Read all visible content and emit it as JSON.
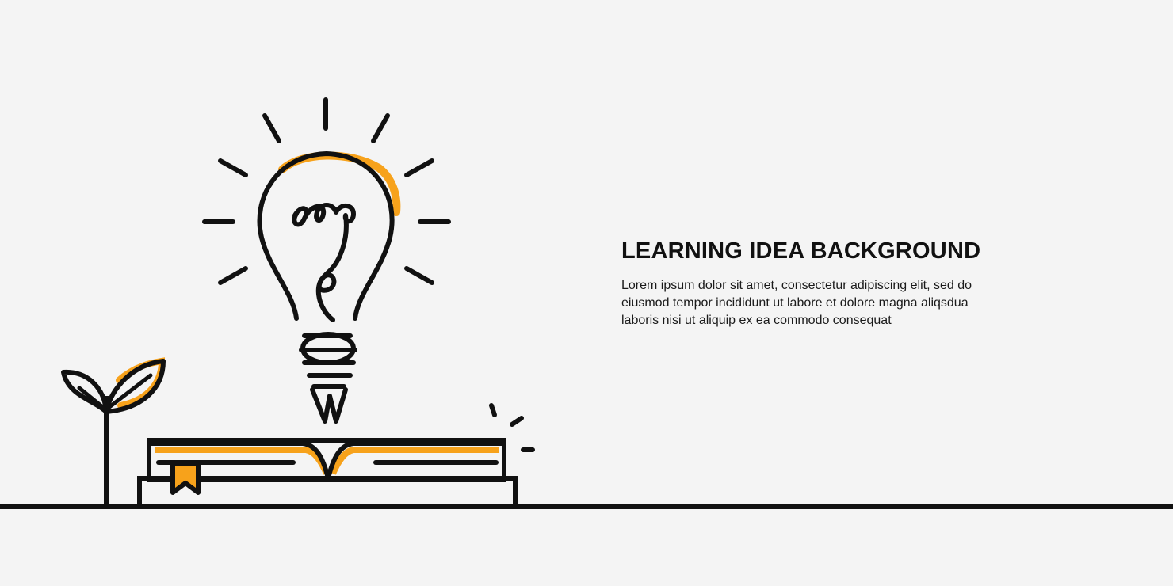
{
  "headline": "LEARNING IDEA BACKGROUND",
  "body_lines": [
    "Lorem ipsum dolor sit amet, consectetur adipiscing elit, sed do",
    "eiusmod tempor incididunt ut labore et dolore magna aliqsdua",
    "laboris nisi ut aliquip ex ea commodo consequat"
  ],
  "colors": {
    "background": "#f4f4f4",
    "line": "#111111",
    "accent": "#f7a21b"
  },
  "icons": [
    "lightbulb-icon",
    "open-book-icon",
    "sprout-icon",
    "bookmark-icon"
  ]
}
